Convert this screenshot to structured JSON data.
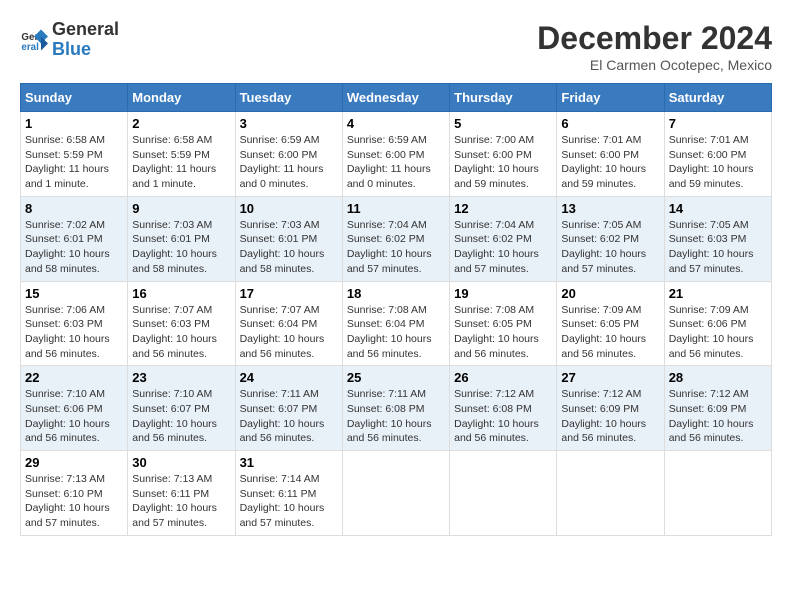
{
  "header": {
    "logo": {
      "general": "General",
      "blue": "Blue"
    },
    "month": "December 2024",
    "location": "El Carmen Ocotepec, Mexico"
  },
  "weekdays": [
    "Sunday",
    "Monday",
    "Tuesday",
    "Wednesday",
    "Thursday",
    "Friday",
    "Saturday"
  ],
  "weeks": [
    [
      {
        "day": "1",
        "sunrise": "6:58 AM",
        "sunset": "5:59 PM",
        "daylight": "11 hours and 1 minute."
      },
      {
        "day": "2",
        "sunrise": "6:58 AM",
        "sunset": "5:59 PM",
        "daylight": "11 hours and 1 minute."
      },
      {
        "day": "3",
        "sunrise": "6:59 AM",
        "sunset": "6:00 PM",
        "daylight": "11 hours and 0 minutes."
      },
      {
        "day": "4",
        "sunrise": "6:59 AM",
        "sunset": "6:00 PM",
        "daylight": "11 hours and 0 minutes."
      },
      {
        "day": "5",
        "sunrise": "7:00 AM",
        "sunset": "6:00 PM",
        "daylight": "10 hours and 59 minutes."
      },
      {
        "day": "6",
        "sunrise": "7:01 AM",
        "sunset": "6:00 PM",
        "daylight": "10 hours and 59 minutes."
      },
      {
        "day": "7",
        "sunrise": "7:01 AM",
        "sunset": "6:00 PM",
        "daylight": "10 hours and 59 minutes."
      }
    ],
    [
      {
        "day": "8",
        "sunrise": "7:02 AM",
        "sunset": "6:01 PM",
        "daylight": "10 hours and 58 minutes."
      },
      {
        "day": "9",
        "sunrise": "7:03 AM",
        "sunset": "6:01 PM",
        "daylight": "10 hours and 58 minutes."
      },
      {
        "day": "10",
        "sunrise": "7:03 AM",
        "sunset": "6:01 PM",
        "daylight": "10 hours and 58 minutes."
      },
      {
        "day": "11",
        "sunrise": "7:04 AM",
        "sunset": "6:02 PM",
        "daylight": "10 hours and 57 minutes."
      },
      {
        "day": "12",
        "sunrise": "7:04 AM",
        "sunset": "6:02 PM",
        "daylight": "10 hours and 57 minutes."
      },
      {
        "day": "13",
        "sunrise": "7:05 AM",
        "sunset": "6:02 PM",
        "daylight": "10 hours and 57 minutes."
      },
      {
        "day": "14",
        "sunrise": "7:05 AM",
        "sunset": "6:03 PM",
        "daylight": "10 hours and 57 minutes."
      }
    ],
    [
      {
        "day": "15",
        "sunrise": "7:06 AM",
        "sunset": "6:03 PM",
        "daylight": "10 hours and 56 minutes."
      },
      {
        "day": "16",
        "sunrise": "7:07 AM",
        "sunset": "6:03 PM",
        "daylight": "10 hours and 56 minutes."
      },
      {
        "day": "17",
        "sunrise": "7:07 AM",
        "sunset": "6:04 PM",
        "daylight": "10 hours and 56 minutes."
      },
      {
        "day": "18",
        "sunrise": "7:08 AM",
        "sunset": "6:04 PM",
        "daylight": "10 hours and 56 minutes."
      },
      {
        "day": "19",
        "sunrise": "7:08 AM",
        "sunset": "6:05 PM",
        "daylight": "10 hours and 56 minutes."
      },
      {
        "day": "20",
        "sunrise": "7:09 AM",
        "sunset": "6:05 PM",
        "daylight": "10 hours and 56 minutes."
      },
      {
        "day": "21",
        "sunrise": "7:09 AM",
        "sunset": "6:06 PM",
        "daylight": "10 hours and 56 minutes."
      }
    ],
    [
      {
        "day": "22",
        "sunrise": "7:10 AM",
        "sunset": "6:06 PM",
        "daylight": "10 hours and 56 minutes."
      },
      {
        "day": "23",
        "sunrise": "7:10 AM",
        "sunset": "6:07 PM",
        "daylight": "10 hours and 56 minutes."
      },
      {
        "day": "24",
        "sunrise": "7:11 AM",
        "sunset": "6:07 PM",
        "daylight": "10 hours and 56 minutes."
      },
      {
        "day": "25",
        "sunrise": "7:11 AM",
        "sunset": "6:08 PM",
        "daylight": "10 hours and 56 minutes."
      },
      {
        "day": "26",
        "sunrise": "7:12 AM",
        "sunset": "6:08 PM",
        "daylight": "10 hours and 56 minutes."
      },
      {
        "day": "27",
        "sunrise": "7:12 AM",
        "sunset": "6:09 PM",
        "daylight": "10 hours and 56 minutes."
      },
      {
        "day": "28",
        "sunrise": "7:12 AM",
        "sunset": "6:09 PM",
        "daylight": "10 hours and 56 minutes."
      }
    ],
    [
      {
        "day": "29",
        "sunrise": "7:13 AM",
        "sunset": "6:10 PM",
        "daylight": "10 hours and 57 minutes."
      },
      {
        "day": "30",
        "sunrise": "7:13 AM",
        "sunset": "6:11 PM",
        "daylight": "10 hours and 57 minutes."
      },
      {
        "day": "31",
        "sunrise": "7:14 AM",
        "sunset": "6:11 PM",
        "daylight": "10 hours and 57 minutes."
      },
      null,
      null,
      null,
      null
    ]
  ],
  "labels": {
    "sunrise": "Sunrise:",
    "sunset": "Sunset:",
    "daylight": "Daylight:"
  }
}
